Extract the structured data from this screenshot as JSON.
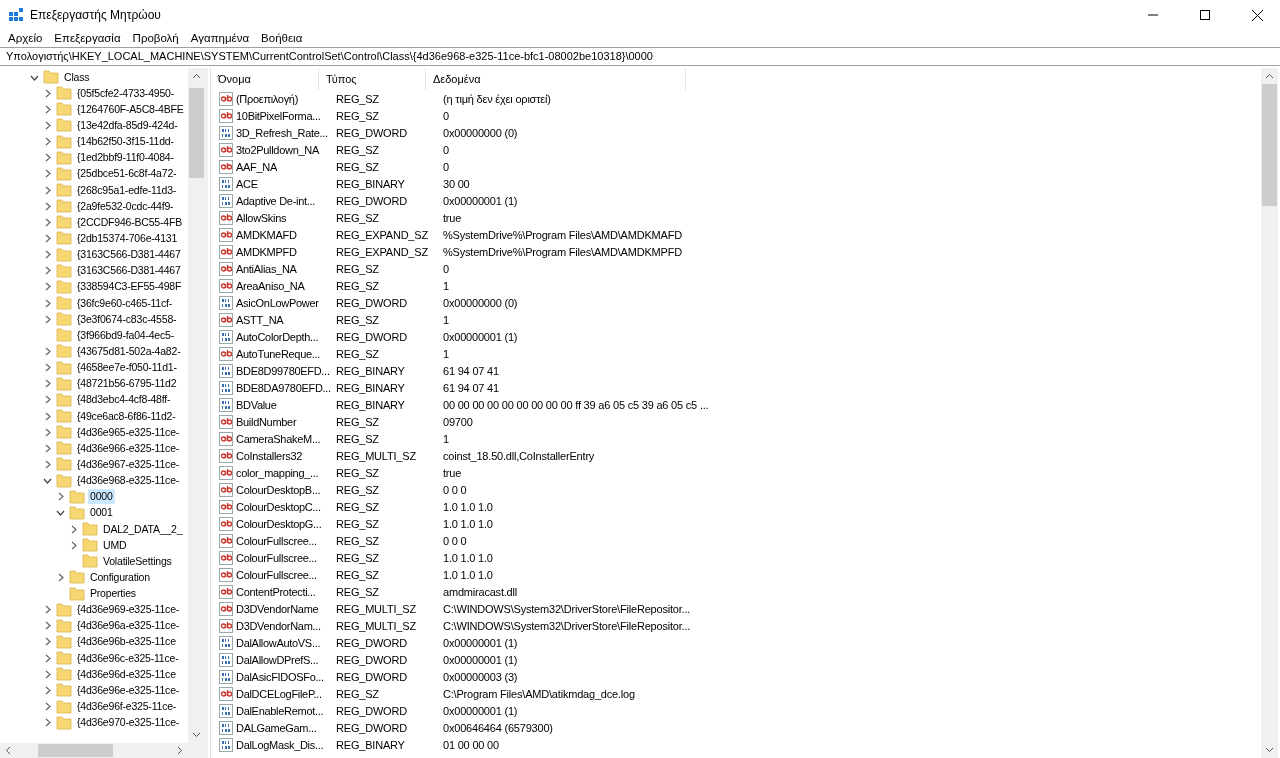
{
  "window": {
    "title": "Επεξεργαστής Μητρώου"
  },
  "menu": [
    "Αρχείο",
    "Επεξεργασία",
    "Προβολή",
    "Αγαπημένα",
    "Βοήθεια"
  ],
  "address": "Υπολογιστής\\HKEY_LOCAL_MACHINE\\SYSTEM\\CurrentControlSet\\Control\\Class\\{4d36e968-e325-11ce-bfc1-08002be10318}\\0000",
  "tree": [
    {
      "label": "Class",
      "kind": "branch",
      "expanded": true,
      "selected": false,
      "children": [
        {
          "label": "{05f5cfe2-4733-4950-",
          "kind": "branch",
          "expanded": false,
          "selected": false
        },
        {
          "label": "{1264760F-A5C8-4BFE",
          "kind": "branch",
          "expanded": false,
          "selected": false
        },
        {
          "label": "{13e42dfa-85d9-424d-",
          "kind": "branch",
          "expanded": false,
          "selected": false
        },
        {
          "label": "{14b62f50-3f15-11dd-",
          "kind": "branch",
          "expanded": false,
          "selected": false
        },
        {
          "label": "{1ed2bbf9-11f0-4084-",
          "kind": "branch",
          "expanded": false,
          "selected": false
        },
        {
          "label": "{25dbce51-6c8f-4a72-",
          "kind": "branch",
          "expanded": false,
          "selected": false
        },
        {
          "label": "{268c95a1-edfe-11d3-",
          "kind": "branch",
          "expanded": false,
          "selected": false
        },
        {
          "label": "{2a9fe532-0cdc-44f9-",
          "kind": "branch",
          "expanded": false,
          "selected": false
        },
        {
          "label": "{2CCDF946-BC55-4FB",
          "kind": "branch",
          "expanded": false,
          "selected": false
        },
        {
          "label": "{2db15374-706e-4131",
          "kind": "branch",
          "expanded": false,
          "selected": false
        },
        {
          "label": "{3163C566-D381-4467",
          "kind": "branch",
          "expanded": false,
          "selected": false
        },
        {
          "label": "{3163C566-D381-4467",
          "kind": "branch",
          "expanded": false,
          "selected": false
        },
        {
          "label": "{338594C3-EF55-498F",
          "kind": "branch",
          "expanded": false,
          "selected": false
        },
        {
          "label": "{36fc9e60-c465-11cf-",
          "kind": "branch",
          "expanded": false,
          "selected": false
        },
        {
          "label": "{3e3f0674-c83c-4558-",
          "kind": "branch",
          "expanded": false,
          "selected": false
        },
        {
          "label": "{3f966bd9-fa04-4ec5-",
          "kind": "leaf",
          "selected": false
        },
        {
          "label": "{43675d81-502a-4a82-",
          "kind": "branch",
          "expanded": false,
          "selected": false
        },
        {
          "label": "{4658ee7e-f050-11d1-",
          "kind": "branch",
          "expanded": false,
          "selected": false
        },
        {
          "label": "{48721b56-6795-11d2",
          "kind": "branch",
          "expanded": false,
          "selected": false
        },
        {
          "label": "{48d3ebc4-4cf8-48ff-",
          "kind": "branch",
          "expanded": false,
          "selected": false
        },
        {
          "label": "{49ce6ac8-6f86-11d2-",
          "kind": "branch",
          "expanded": false,
          "selected": false
        },
        {
          "label": "{4d36e965-e325-11ce-",
          "kind": "branch",
          "expanded": false,
          "selected": false
        },
        {
          "label": "{4d36e966-e325-11ce-",
          "kind": "branch",
          "expanded": false,
          "selected": false
        },
        {
          "label": "{4d36e967-e325-11ce-",
          "kind": "branch",
          "expanded": false,
          "selected": false
        },
        {
          "label": "{4d36e968-e325-11ce-",
          "kind": "branch",
          "expanded": true,
          "selected": false,
          "children": [
            {
              "label": "0000",
              "kind": "branch",
              "expanded": false,
              "selected": true
            },
            {
              "label": "0001",
              "kind": "branch",
              "expanded": true,
              "selected": false,
              "children": [
                {
                  "label": "DAL2_DATA__2_",
                  "kind": "branch",
                  "expanded": false,
                  "selected": false
                },
                {
                  "label": "UMD",
                  "kind": "branch",
                  "expanded": false,
                  "selected": false
                },
                {
                  "label": "VolatileSettings",
                  "kind": "leaf",
                  "selected": false
                }
              ]
            },
            {
              "label": "Configuration",
              "kind": "branch",
              "expanded": false,
              "selected": false
            },
            {
              "label": "Properties",
              "kind": "leaf",
              "selected": false
            }
          ]
        },
        {
          "label": "{4d36e969-e325-11ce-",
          "kind": "branch",
          "expanded": false,
          "selected": false
        },
        {
          "label": "{4d36e96a-e325-11ce-",
          "kind": "branch",
          "expanded": false,
          "selected": false
        },
        {
          "label": "{4d36e96b-e325-11ce",
          "kind": "branch",
          "expanded": false,
          "selected": false
        },
        {
          "label": "{4d36e96c-e325-11ce-",
          "kind": "branch",
          "expanded": false,
          "selected": false
        },
        {
          "label": "{4d36e96d-e325-11ce",
          "kind": "branch",
          "expanded": false,
          "selected": false
        },
        {
          "label": "{4d36e96e-e325-11ce-",
          "kind": "branch",
          "expanded": false,
          "selected": false
        },
        {
          "label": "{4d36e96f-e325-11ce-",
          "kind": "branch",
          "expanded": false,
          "selected": false
        },
        {
          "label": "{4d36e970-e325-11ce-",
          "kind": "branch",
          "expanded": false,
          "selected": false
        }
      ]
    }
  ],
  "columns": [
    "Όνομα",
    "Τύπος",
    "Δεδομένα"
  ],
  "values": [
    {
      "kind": "string",
      "name": "(Προεπιλογή)",
      "type": "REG_SZ",
      "data": "(η τιμή δεν έχει οριστεί)"
    },
    {
      "kind": "string",
      "name": "10BitPixelForma...",
      "type": "REG_SZ",
      "data": "0"
    },
    {
      "kind": "binary",
      "name": "3D_Refresh_Rate...",
      "type": "REG_DWORD",
      "data": "0x00000000 (0)"
    },
    {
      "kind": "string",
      "name": "3to2Pulldown_NA",
      "type": "REG_SZ",
      "data": "0"
    },
    {
      "kind": "string",
      "name": "AAF_NA",
      "type": "REG_SZ",
      "data": "0"
    },
    {
      "kind": "binary",
      "name": "ACE",
      "type": "REG_BINARY",
      "data": "30 00"
    },
    {
      "kind": "binary",
      "name": "Adaptive De-int...",
      "type": "REG_DWORD",
      "data": "0x00000001 (1)"
    },
    {
      "kind": "string",
      "name": "AllowSkins",
      "type": "REG_SZ",
      "data": "true"
    },
    {
      "kind": "string",
      "name": "AMDKMAFD",
      "type": "REG_EXPAND_SZ",
      "data": "%SystemDrive%\\Program Files\\AMD\\AMDKMAFD"
    },
    {
      "kind": "string",
      "name": "AMDKMPFD",
      "type": "REG_EXPAND_SZ",
      "data": "%SystemDrive%\\Program Files\\AMD\\AMDKMPFD"
    },
    {
      "kind": "string",
      "name": "AntiAlias_NA",
      "type": "REG_SZ",
      "data": "0"
    },
    {
      "kind": "string",
      "name": "AreaAniso_NA",
      "type": "REG_SZ",
      "data": "1"
    },
    {
      "kind": "binary",
      "name": "AsicOnLowPower",
      "type": "REG_DWORD",
      "data": "0x00000000 (0)"
    },
    {
      "kind": "string",
      "name": "ASTT_NA",
      "type": "REG_SZ",
      "data": "1"
    },
    {
      "kind": "binary",
      "name": "AutoColorDepth...",
      "type": "REG_DWORD",
      "data": "0x00000001 (1)"
    },
    {
      "kind": "string",
      "name": "AutoTuneReque...",
      "type": "REG_SZ",
      "data": "1"
    },
    {
      "kind": "binary",
      "name": "BDE8D99780EFD...",
      "type": "REG_BINARY",
      "data": "61 94 07 41"
    },
    {
      "kind": "binary",
      "name": "BDE8DA9780EFD...",
      "type": "REG_BINARY",
      "data": "61 94 07 41"
    },
    {
      "kind": "binary",
      "name": "BDValue",
      "type": "REG_BINARY",
      "data": "00 00 00 00 00 00 00 00 00 ff 39 a6 05 c5 39 a6 05 c5 ..."
    },
    {
      "kind": "string",
      "name": "BuildNumber",
      "type": "REG_SZ",
      "data": "09700"
    },
    {
      "kind": "string",
      "name": "CameraShakeM...",
      "type": "REG_SZ",
      "data": "1"
    },
    {
      "kind": "string",
      "name": "CoInstallers32",
      "type": "REG_MULTI_SZ",
      "data": "coinst_18.50.dll,CoInstallerEntry"
    },
    {
      "kind": "string",
      "name": "color_mapping_...",
      "type": "REG_SZ",
      "data": "true"
    },
    {
      "kind": "string",
      "name": "ColourDesktopB...",
      "type": "REG_SZ",
      "data": "0 0 0"
    },
    {
      "kind": "string",
      "name": "ColourDesktopC...",
      "type": "REG_SZ",
      "data": "1.0 1.0 1.0"
    },
    {
      "kind": "string",
      "name": "ColourDesktopG...",
      "type": "REG_SZ",
      "data": "1.0 1.0 1.0"
    },
    {
      "kind": "string",
      "name": "ColourFullscree...",
      "type": "REG_SZ",
      "data": "0 0 0"
    },
    {
      "kind": "string",
      "name": "ColourFullscree...",
      "type": "REG_SZ",
      "data": "1.0 1.0 1.0"
    },
    {
      "kind": "string",
      "name": "ColourFullscree...",
      "type": "REG_SZ",
      "data": "1.0 1.0 1.0"
    },
    {
      "kind": "string",
      "name": "ContentProtecti...",
      "type": "REG_SZ",
      "data": "amdmiracast.dll"
    },
    {
      "kind": "string",
      "name": "D3DVendorName",
      "type": "REG_MULTI_SZ",
      "data": "C:\\WINDOWS\\System32\\DriverStore\\FileRepositor..."
    },
    {
      "kind": "string",
      "name": "D3DVendorNam...",
      "type": "REG_MULTI_SZ",
      "data": "C:\\WINDOWS\\System32\\DriverStore\\FileRepositor..."
    },
    {
      "kind": "binary",
      "name": "DalAllowAutoVS...",
      "type": "REG_DWORD",
      "data": "0x00000001 (1)"
    },
    {
      "kind": "binary",
      "name": "DalAllowDPrefS...",
      "type": "REG_DWORD",
      "data": "0x00000001 (1)"
    },
    {
      "kind": "binary",
      "name": "DalAsicFIDOSFo...",
      "type": "REG_DWORD",
      "data": "0x00000003 (3)"
    },
    {
      "kind": "string",
      "name": "DalDCELogFileP...",
      "type": "REG_SZ",
      "data": "C:\\Program Files\\AMD\\atikmdag_dce.log"
    },
    {
      "kind": "binary",
      "name": "DalEnableRemot...",
      "type": "REG_DWORD",
      "data": "0x00000001 (1)"
    },
    {
      "kind": "binary",
      "name": "DALGameGam...",
      "type": "REG_DWORD",
      "data": "0x00646464 (6579300)"
    },
    {
      "kind": "binary",
      "name": "DalLogMask_Dis...",
      "type": "REG_BINARY",
      "data": "01 00 00 00"
    }
  ]
}
